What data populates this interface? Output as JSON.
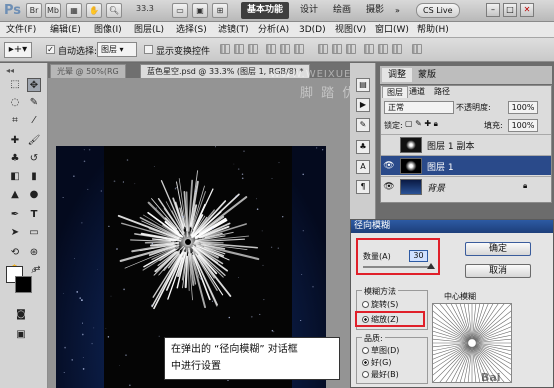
{
  "app": {
    "logo": "Ps",
    "zoom_level": "33.3",
    "workspaces": [
      "基本功能",
      "设计",
      "绘画",
      "摄影"
    ],
    "cs_live": "CS Live",
    "window_controls": [
      "–",
      "□",
      "✕"
    ]
  },
  "menu": [
    "文件(F)",
    "编辑(E)",
    "图像(I)",
    "图层(L)",
    "选择(S)",
    "滤镜(T)",
    "分析(A)",
    "3D(D)",
    "视图(V)",
    "窗口(W)",
    "帮助(H)"
  ],
  "options": {
    "auto_select_label": "自动选择:",
    "auto_select_value": "图层",
    "show_transform_label": "显示变换控件"
  },
  "tabs": {
    "doc1": "光晕 @ 50%(RG",
    "doc2": "蓝色星空.psd @ 33.3% (图层 1, RGB/8) *"
  },
  "watermark": {
    "url": "WWW.WEIXUECN.COM",
    "site": "脚 踏 优 先"
  },
  "panels": {
    "top_tabs": [
      "调整",
      "蒙版"
    ],
    "layer_tabs": [
      "图层",
      "通道",
      "路径"
    ],
    "blend_mode": "正常",
    "opacity_label": "不透明度:",
    "opacity_value": "100%",
    "lock_label": "锁定:",
    "fill_label": "填充:",
    "fill_value": "100%",
    "layers": [
      {
        "name": "图层 1 副本",
        "visible": false
      },
      {
        "name": "图层 1",
        "visible": true
      },
      {
        "name": "背景",
        "visible": true
      }
    ]
  },
  "dialog": {
    "title": "径向模糊",
    "amount_label": "数量(A)",
    "amount_value": "30",
    "ok": "确定",
    "cancel": "取消",
    "method_label": "模糊方法",
    "method_spin": "旋转(S)",
    "method_zoom": "缩放(Z)",
    "quality_label": "品质:",
    "quality_draft": "草图(D)",
    "quality_good": "好(G)",
    "quality_best": "最好(B)",
    "center_label": "中心模糊"
  },
  "caption": {
    "line1": "在弹出的 “径向模糊” 对话框",
    "line2": "中进行设置"
  },
  "baidu_watermark": "Bai"
}
